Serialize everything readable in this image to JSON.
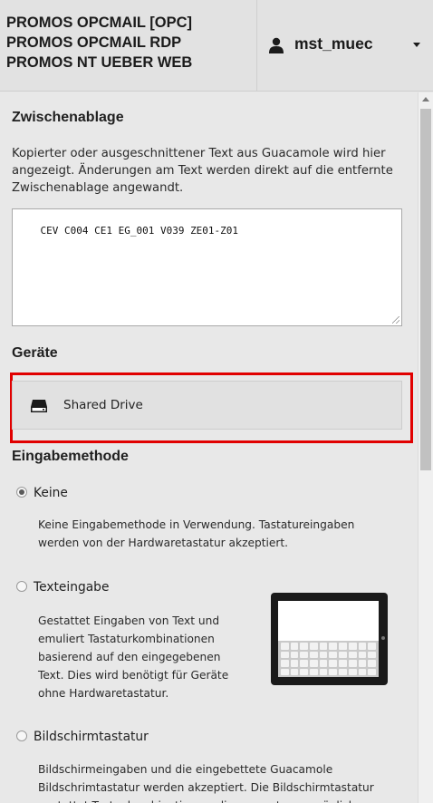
{
  "header": {
    "connections": [
      "PROMOS OPCMAIL [OPC]",
      "PROMOS OPCMAIL RDP",
      "PROMOS NT UEBER WEB"
    ],
    "user": {
      "name": "mst_muec",
      "icon": "user-icon"
    }
  },
  "clipboard": {
    "title": "Zwischenablage",
    "description": "Kopierter oder ausgeschnittener Text aus Guacamole wird hier angezeigt. Änderungen am Text werden direkt auf die entfernte Zwischenablage angewandt.",
    "value": "CEV C004 CE1 EG_001 V039 ZE01-Z01"
  },
  "devices": {
    "title": "Geräte",
    "items": [
      {
        "label": "Shared Drive",
        "icon": "drive-icon"
      }
    ],
    "highlight_color": "#e10000"
  },
  "input_method": {
    "title": "Eingabemethode",
    "options": [
      {
        "label": "Keine",
        "checked": true,
        "description": "Keine Eingabemethode in Verwendung. Tastatureingaben werden von der Hardwaretastatur akzeptiert."
      },
      {
        "label": "Texteingabe",
        "checked": false,
        "description": "Gestattet Eingaben von Text und emuliert Tastaturkombinationen basierend auf den eingegebenen Text. Dies wird benötigt für Geräte ohne Hardwaretastatur."
      },
      {
        "label": "Bildschirmtastatur",
        "checked": false,
        "description": "Bildschirmeingaben und die eingebettete Guacamole Bildschrimtastatur werden akzeptiert. Die Bildschirmtastatur gestattet Tastenkombinationen, die ansonsten unmöglich sind"
      }
    ]
  }
}
